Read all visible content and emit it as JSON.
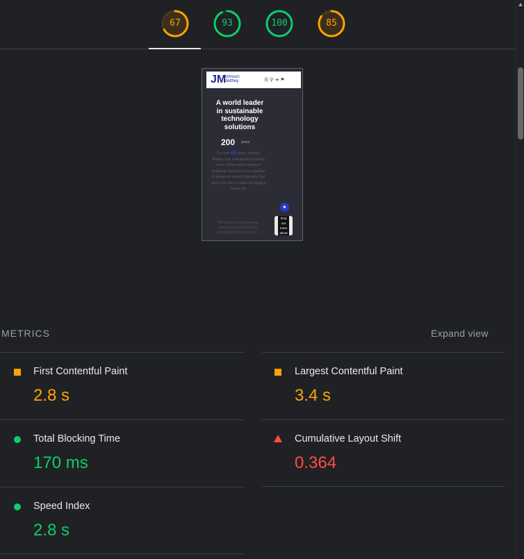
{
  "scores": {
    "items": [
      {
        "value": "67",
        "score": 0.67,
        "color": "#ffa400",
        "track": "#4a3a1a",
        "fill_bg": "#3b2f1c"
      },
      {
        "value": "93",
        "score": 0.93,
        "color": "#0cce6b",
        "track": "#1a3f2a",
        "fill_bg": "#202124"
      },
      {
        "value": "100",
        "score": 1.0,
        "color": "#0cce6b",
        "track": "#1a3f2a",
        "fill_bg": "#202124"
      },
      {
        "value": "85",
        "score": 0.85,
        "color": "#ffa400",
        "track": "#4a3a1a",
        "fill_bg": "#3b2f1c"
      }
    ]
  },
  "screenshot": {
    "logo": "JM",
    "brand_line1": "Johnson",
    "brand_line2": "Matthey",
    "headline": "A world leader in sustainable technology solutions",
    "big_number": "200",
    "years_label": "years",
    "paragraph_pre": "For over ",
    "paragraph_highlight": "200",
    "paragraph_post": " years Johnson Matthey has contributed to solving some of the world's toughest problems, leaning on our expertise in advanced metals chemistry. But now is the time to make our biggest impact yet.",
    "paragraph2": "The world's leading energy, chemicals and automotive companies depend on our...",
    "find_out_more": "Find out more about"
  },
  "metrics": {
    "title": "METRICS",
    "expand_label": "Expand view",
    "items": [
      {
        "label": "First Contentful Paint",
        "value": "2.8 s",
        "status": "average",
        "icon": "orange-square-icon"
      },
      {
        "label": "Largest Contentful Paint",
        "value": "3.4 s",
        "status": "average",
        "icon": "orange-square-icon"
      },
      {
        "label": "Total Blocking Time",
        "value": "170 ms",
        "status": "pass",
        "icon": "green-circle-icon"
      },
      {
        "label": "Cumulative Layout Shift",
        "value": "0.364",
        "status": "fail",
        "icon": "red-triangle-icon"
      },
      {
        "label": "Speed Index",
        "value": "2.8 s",
        "status": "pass",
        "icon": "green-circle-icon"
      }
    ]
  },
  "colors": {
    "average": "#ffa400",
    "pass": "#0cce6b",
    "fail": "#ff4e42",
    "background": "#202124"
  }
}
